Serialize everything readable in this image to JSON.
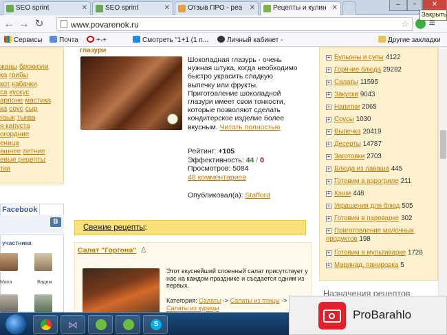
{
  "browser": {
    "tabs": [
      {
        "title": "SEO sprint"
      },
      {
        "title": "SEO sprint"
      },
      {
        "title": "Отзыв ПРО - реа"
      },
      {
        "title": "Рецепты и кулин"
      }
    ],
    "url": "www.povarenok.ru",
    "tooltip": "Закрыть",
    "bookmarks": [
      {
        "label": "Сервисы"
      },
      {
        "label": "Почта"
      },
      {
        "label": "+-+"
      },
      {
        "label": "Смотреть \"1+1 (1 п..."
      },
      {
        "label": "Личный кабинет -"
      },
      {
        "label": "Другие закладки"
      }
    ]
  },
  "left_links": [
    "жаны",
    "брокколи",
    "ка",
    "грибы",
    "кот",
    "кабачки",
    "са",
    "кускус",
    "арпоне",
    "мастика",
    "ка",
    "соус",
    "сыр",
    "язык",
    "тыква",
    "я капуста",
    "огордние",
    "еница",
    "ашнее",
    "летние",
    "евые рецепты",
    "тки"
  ],
  "facebook": {
    "tab_label": "Facebook",
    "vk_label": "В",
    "participants_label": "участника",
    "people": [
      "Maria",
      "Вадим"
    ]
  },
  "glaze": {
    "title": "глазури",
    "description": "Шоколадная глазурь - очень нужная штука, когда необходимо быстро украсить сладкую выпечку или фрукты. Приготовление шоколадной глазури имеет свои тонкости, которые позволяют сделать кондитерское изделие более вкусным.",
    "read_more": "Читать полностью",
    "rating_label": "Рейтинг:",
    "rating_value": "+105",
    "efficiency_label": "Эффективность:",
    "efficiency_good": "44",
    "efficiency_sep": "/",
    "efficiency_bad": "0",
    "views_label": "Просмотров:",
    "views_value": "5084",
    "comments": "48 комментариев",
    "published_label": "Опубликовал(а):",
    "author": "Stafford"
  },
  "fresh": {
    "label": "Свежие рецепты",
    "colon": ":"
  },
  "salad": {
    "title": "Салат \"Горгона\"",
    "description": "Этот вкуснейший слоенный салат присутствует у нас на каждом празднике и съедается одним из первых.",
    "category_label": "Категория:",
    "cat1": "Салаты",
    "arrow": "->",
    "cat2": "Салаты из птицы",
    "cat3": "Салаты из курицы"
  },
  "categories": [
    {
      "name": "Бульоны и супы",
      "count": "4122"
    },
    {
      "name": "Горячие блюда",
      "count": "29282"
    },
    {
      "name": "Салаты",
      "count": "11595"
    },
    {
      "name": "Закуски",
      "count": "9043"
    },
    {
      "name": "Напитки",
      "count": "2065"
    },
    {
      "name": "Соусы",
      "count": "1030"
    },
    {
      "name": "Выпечка",
      "count": "20419"
    },
    {
      "name": "Десерты",
      "count": "14787"
    },
    {
      "name": "Заготовки",
      "count": "2703"
    },
    {
      "name": "Блюда из лаваша",
      "count": "445"
    },
    {
      "name": "Готовим в аэрогриле",
      "count": "211"
    },
    {
      "name": "Каши",
      "count": "448"
    },
    {
      "name": "Украшения для блюд",
      "count": "505"
    },
    {
      "name": "Готовим в пароварке",
      "count": "302"
    },
    {
      "name": "Приготовление молочных продуктов",
      "count": "198"
    },
    {
      "name": "Готовим в мультиварке",
      "count": "1728"
    },
    {
      "name": "Маринад, панировка",
      "count": "5"
    }
  ],
  "purpose_heading": "Назначения рецептов",
  "ad": {
    "brand": "ProBarahlo"
  },
  "colors": {
    "link": "#c17a00",
    "panel": "#fdf1cf",
    "fresh_bar": "#f9e27a",
    "positive": "#2a8a2a",
    "negative": "#c00000"
  }
}
